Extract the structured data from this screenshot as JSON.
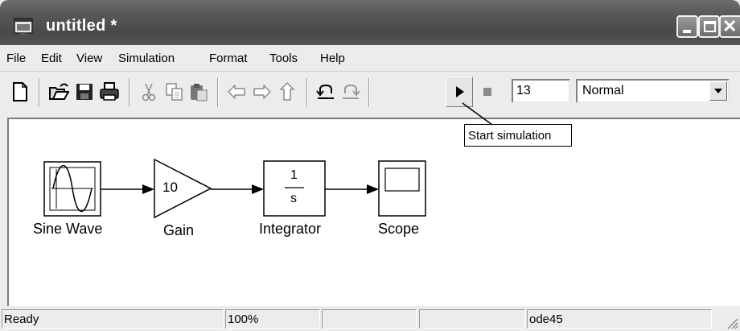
{
  "window": {
    "title": "untitled *"
  },
  "menu": [
    "File",
    "Edit",
    "View",
    "Simulation",
    "Format",
    "Tools",
    "Help"
  ],
  "toolbar": {
    "icons": [
      "new-model-icon",
      "open-icon",
      "save-icon",
      "print-icon",
      "cut-icon",
      "copy-icon",
      "paste-icon",
      "back-icon",
      "forward-icon",
      "up-icon",
      "undo-icon",
      "redo-icon",
      "start-simulation-icon",
      "stop-simulation-icon"
    ],
    "stop_time": "13",
    "sim_mode": "Normal",
    "tooltip": "Start simulation"
  },
  "blocks": {
    "sine_label": "Sine Wave",
    "gain_value": "10",
    "gain_label": "Gain",
    "integrator_num": "1",
    "integrator_den": "s",
    "integrator_label": "Integrator",
    "scope_label": "Scope"
  },
  "status": {
    "state": "Ready",
    "zoom": "100%",
    "solver": "ode45"
  }
}
